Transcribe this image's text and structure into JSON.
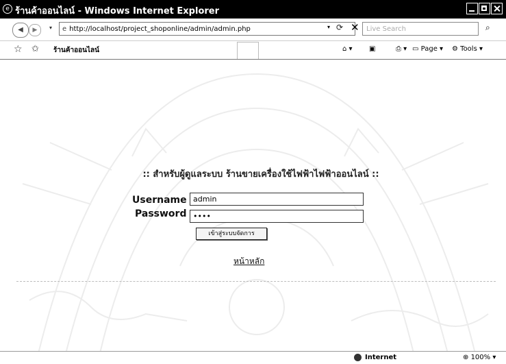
{
  "window": {
    "title": "ร้านค้าออนไลน์ - Windows Internet Explorer",
    "brand_color": "#000000"
  },
  "toolbar": {
    "url": "http://localhost/project_shoponline/admin/admin.php",
    "search_placeholder": "Live Search",
    "tab_title": "ร้านค้าออนไลน์",
    "page_label": "Page",
    "tools_label": "Tools"
  },
  "login": {
    "title": ":: สำหรับผู้ดูแลระบบ ร้านขายเครื่องใช้ไฟฟ้าไฟฟ้าออนไลน์ ::",
    "username_label": "Username :",
    "username_value": "admin",
    "password_label": "Password :",
    "password_value": "••••",
    "submit_label": "เข้าสู่ระบบจัดการ"
  },
  "home_link": "หน้าหลัก",
  "status": {
    "zone": "Internet",
    "zoom": "100%"
  },
  "icons": [
    "ie-icon",
    "back-icon",
    "forward-icon",
    "page-icon",
    "refresh-icon",
    "stop-icon",
    "search-icon",
    "favorites-star-icon",
    "add-favorites-icon",
    "home-icon",
    "feeds-icon",
    "print-icon",
    "globe-icon"
  ]
}
